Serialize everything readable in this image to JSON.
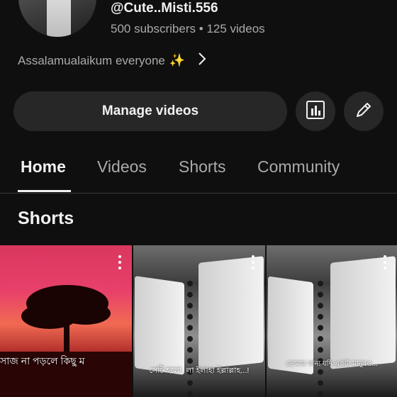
{
  "channel": {
    "handle": "@Cute..Misti.556",
    "subscribers": "500 subscribers",
    "separator": "•",
    "videos": "125 videos",
    "description": "Assalamualaikum everyone",
    "description_emoji": "✨"
  },
  "actions": {
    "manage_label": "Manage videos",
    "analytics_icon": "bar-chart-icon",
    "edit_icon": "pencil-icon"
  },
  "tabs": [
    {
      "label": "Home",
      "active": true
    },
    {
      "label": "Videos",
      "active": false
    },
    {
      "label": "Shorts",
      "active": false
    },
    {
      "label": "Community",
      "active": false
    }
  ],
  "shorts_section": {
    "title": "Shorts",
    "items": [
      {
        "caption": "সাজ না পড়লে কিছু ম"
      },
      {
        "caption": "সেটি হলো, লা ইলাহা ইল্লাল্লাহ...!"
      },
      {
        "caption": "তোমার জন্য যদি একটা মানুষও..."
      }
    ]
  }
}
